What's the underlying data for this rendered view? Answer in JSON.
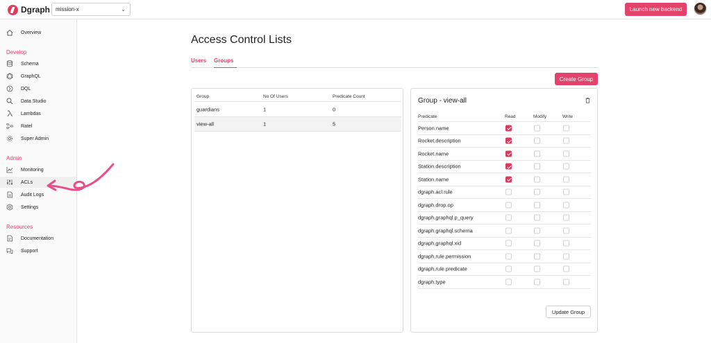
{
  "app": {
    "logo_text": "Dgraph",
    "backend": "mission-x",
    "launch_label": "Launch new backend"
  },
  "sidebar": {
    "overview": "Overview",
    "sections": {
      "develop": "Develop",
      "admin": "Admin",
      "resources": "Resources"
    },
    "develop_items": [
      "Schema",
      "GraphQL",
      "DQL",
      "Data Studio",
      "Lambdas",
      "Ratel",
      "Super Admin"
    ],
    "admin_items": [
      "Monitoring",
      "ACLs",
      "Audit Logs",
      "Settings"
    ],
    "resource_items": [
      "Documentation",
      "Support"
    ]
  },
  "main": {
    "title": "Access Control Lists",
    "tabs": [
      "Users",
      "Groups"
    ],
    "active_tab": "Groups",
    "create_label": "Create Group"
  },
  "groups_table": {
    "headers": [
      "Group",
      "No Of Users",
      "Predicate Count"
    ],
    "rows": [
      {
        "group": "guardians",
        "users": "1",
        "predicates": "0"
      },
      {
        "group": "view-all",
        "users": "1",
        "predicates": "5"
      }
    ],
    "selected": "view-all"
  },
  "group_detail": {
    "title": "Group - view-all",
    "headers": [
      "Predicate",
      "Read",
      "Modify",
      "Write"
    ],
    "predicates": [
      {
        "name": "Person.name",
        "read": true,
        "modify": false,
        "write": false
      },
      {
        "name": "Rocket.description",
        "read": true,
        "modify": false,
        "write": false
      },
      {
        "name": "Rocket.name",
        "read": true,
        "modify": false,
        "write": false
      },
      {
        "name": "Station.description",
        "read": true,
        "modify": false,
        "write": false
      },
      {
        "name": "Station.name",
        "read": true,
        "modify": false,
        "write": false
      },
      {
        "name": "dgraph.acl.rule",
        "read": false,
        "modify": false,
        "write": false
      },
      {
        "name": "dgraph.drop.op",
        "read": false,
        "modify": false,
        "write": false
      },
      {
        "name": "dgraph.graphql.p_query",
        "read": false,
        "modify": false,
        "write": false
      },
      {
        "name": "dgraph.graphql.schema",
        "read": false,
        "modify": false,
        "write": false
      },
      {
        "name": "dgraph.graphql.xid",
        "read": false,
        "modify": false,
        "write": false
      },
      {
        "name": "dgraph.rule.permission",
        "read": false,
        "modify": false,
        "write": false
      },
      {
        "name": "dgraph.rule.predicate",
        "read": false,
        "modify": false,
        "write": false
      },
      {
        "name": "dgraph.type",
        "read": false,
        "modify": false,
        "write": false
      }
    ],
    "update_label": "Update Group"
  },
  "colors": {
    "accent": "#e3426a",
    "checkbox_checked": "#d93a5e"
  }
}
